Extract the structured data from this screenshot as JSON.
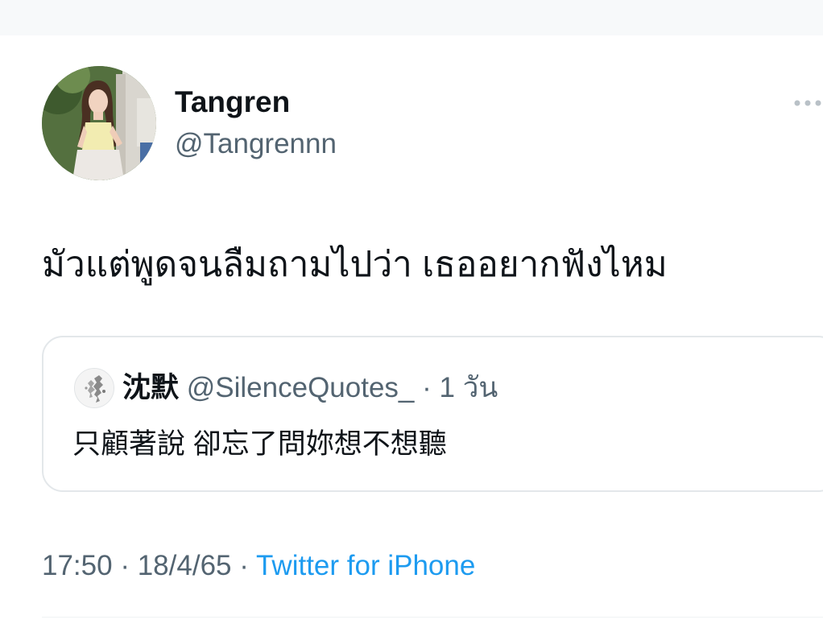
{
  "tweet": {
    "author": {
      "display_name": "Tangren",
      "handle": "@Tangrennn",
      "avatar_icon": "profile-photo"
    },
    "more_icon": "more-horizontal-icon",
    "text": "มัวแต่พูดจนลืมถามไปว่า เธออยากฟังไหม",
    "quoted": {
      "author_name": "沈默",
      "handle": "@SilenceQuotes_",
      "separator": "·",
      "time": "1 วัน",
      "text": "只顧著說 卻忘了問妳想不想聽"
    },
    "meta": {
      "time": "17:50",
      "sep1": "·",
      "date": "18/4/65",
      "sep2": "·",
      "source": "Twitter for iPhone"
    }
  },
  "colors": {
    "primary_text": "#0f1419",
    "secondary_text": "#536471",
    "link": "#1d9bf0",
    "border": "#e3e7ea"
  }
}
